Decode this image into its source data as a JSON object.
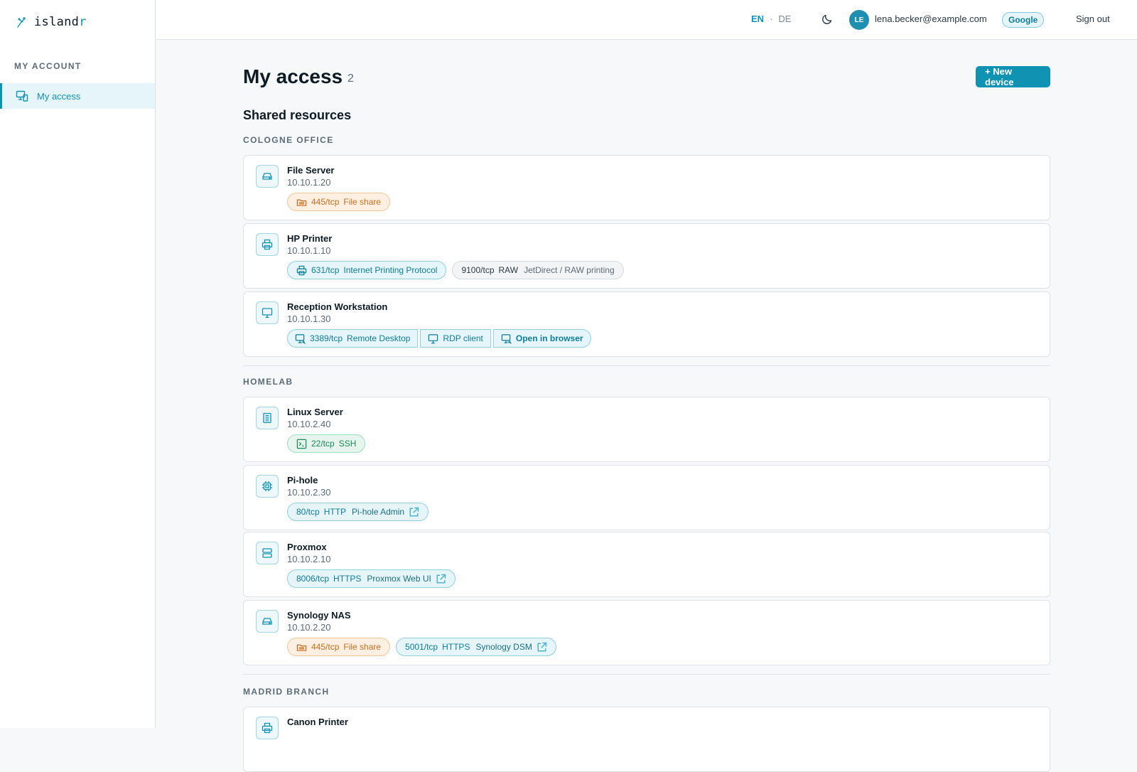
{
  "app": {
    "logo_prefix": "island",
    "logo_accent": "r"
  },
  "sidebar": {
    "section": "MY ACCOUNT",
    "items": [
      {
        "label": "My access"
      }
    ]
  },
  "topbar": {
    "lang_active": "EN",
    "lang_sep": "·",
    "lang_other": "DE",
    "avatar_initials": "LE",
    "email": "lena.becker@example.com",
    "provider": "Google",
    "signout": "Sign out"
  },
  "page": {
    "title": "My access",
    "count": "2",
    "new_button": "+ New device",
    "section_title": "Shared resources"
  },
  "colors": {
    "accent": "#1093b3",
    "orange": "#c76e1e",
    "green": "#1b8a5a"
  },
  "groups": [
    {
      "label": "COLOGNE OFFICE",
      "devices": [
        {
          "name": "File Server",
          "ip": "10.10.1.20",
          "icon": "drive-icon",
          "services": [
            {
              "port": "445/tcp",
              "label": "File share",
              "style": "orange",
              "icon": "folder-icon"
            }
          ]
        },
        {
          "name": "HP Printer",
          "ip": "10.10.1.10",
          "icon": "printer-icon",
          "services": [
            {
              "port": "631/tcp",
              "label": "Internet Printing Protocol",
              "style": "blue",
              "icon": "printer-icon"
            },
            {
              "port": "9100/tcp",
              "proto": "RAW",
              "label": "JetDirect / RAW printing",
              "style": "grey"
            }
          ]
        },
        {
          "name": "Reception Workstation",
          "ip": "10.10.1.30",
          "icon": "monitor-icon",
          "services": [
            {
              "port": "3389/tcp",
              "label": "Remote Desktop",
              "style": "blue",
              "icon": "remote-desktop-icon",
              "rdp_client": "RDP client",
              "open_browser": "Open in browser"
            }
          ]
        }
      ]
    },
    {
      "label": "HOMELAB",
      "devices": [
        {
          "name": "Linux Server",
          "ip": "10.10.2.40",
          "icon": "server-icon",
          "services": [
            {
              "port": "22/tcp",
              "label": "SSH",
              "style": "green",
              "icon": "terminal-icon"
            }
          ]
        },
        {
          "name": "Pi-hole",
          "ip": "10.10.2.30",
          "icon": "chip-icon",
          "services": [
            {
              "port": "80/tcp",
              "proto": "HTTP",
              "label": "Pi-hole Admin",
              "style": "blue",
              "link": true
            }
          ]
        },
        {
          "name": "Proxmox",
          "ip": "10.10.2.10",
          "icon": "rack-icon",
          "services": [
            {
              "port": "8006/tcp",
              "proto": "HTTPS",
              "label": "Proxmox Web UI",
              "style": "blue",
              "link": true
            }
          ]
        },
        {
          "name": "Synology NAS",
          "ip": "10.10.2.20",
          "icon": "drive-icon",
          "services": [
            {
              "port": "445/tcp",
              "label": "File share",
              "style": "orange",
              "icon": "folder-icon"
            },
            {
              "port": "5001/tcp",
              "proto": "HTTPS",
              "label": "Synology DSM",
              "style": "blue",
              "link": true
            }
          ]
        }
      ]
    },
    {
      "label": "MADRID BRANCH",
      "devices": [
        {
          "name": "Canon Printer",
          "icon": "printer-icon",
          "services": []
        }
      ]
    }
  ]
}
